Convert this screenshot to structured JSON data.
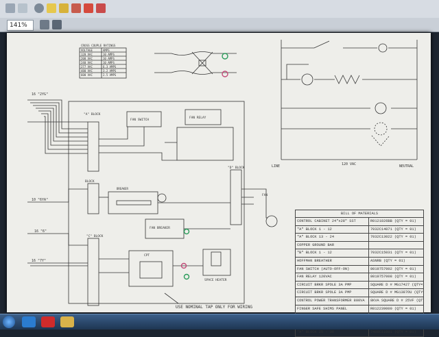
{
  "toolbar": {
    "zoom_value": "141%"
  },
  "drawing": {
    "wire_group_top": "16 \"2YG\"",
    "wire_group_mid1": "10 \"6YA\"",
    "wire_group_mid2": "16 \"6\"",
    "wire_group_bot": "16 \"7Y\"",
    "block_a": "\"A\" BLOCK",
    "block_b": "BLOCK",
    "block_c": "\"C\" BLOCK",
    "block_d": "\"D\" BLOCK",
    "fan_switch": "FAN SWITCH",
    "fan_relay": "FAN RELAY",
    "space_heater": "SPACE HEATER",
    "breaker": "BREAKER",
    "fan_breaker": "FAN BREAKER",
    "cpt": "CPT",
    "heater": "HEATER",
    "line_label": "LINE",
    "neutral_label": "NEUTRAL",
    "vac_label": "120 VAC",
    "fan_label": "FAN",
    "nominal_tap_note": "USE NOMINAL TAP ONLY FOR WIRING",
    "wire_size_title": "CROSS COUPLE RATINGS",
    "wire_size_rows": [
      [
        "VOLTAGE",
        "AMPS"
      ],
      [
        "120 VAC",
        "10 AMPS"
      ],
      [
        "208 VAC",
        "10 AMPS"
      ],
      [
        "240 VAC",
        "10 AMPS"
      ],
      [
        "277 VAC",
        "6.3 AMPS"
      ],
      [
        "480 VAC",
        "3.2 AMPS"
      ],
      [
        "600 VAC",
        "2.5 AMPS"
      ]
    ]
  },
  "bom": {
    "title": "BILL OF MATERIALS",
    "rows": [
      [
        "CONTROL CABINET 24\"x28\" SST",
        "R0121826BB (QTY = 01)"
      ],
      [
        "\"A\" BLOCK 1 - 12",
        "7032C14071 (QTY = 01)"
      ],
      [
        "\"A\" BLOCK 13 - 24",
        "7032C13022 (QTY = 01)"
      ],
      [
        "COPPER GROUND BAR",
        ""
      ],
      [
        "\"B\" BLOCK 1 - 12",
        "7032C15031 (QTY = 01)"
      ],
      [
        "HOFFMAN BREATHER",
        "ASNRB (QTY = 01)"
      ],
      [
        "FAN SWITCH (AUTO-OFF-ON)",
        "8019757002 (QTY = 01)"
      ],
      [
        "FAN RELAY 120VAC",
        "8019757008 (QTY = 01)"
      ],
      [
        "CIRCUIT BRKR SPOLE 3A PMP",
        "SQUARE D # MG17427 (QTY=1)"
      ],
      [
        "CIRCUIT BRKR SPOLE 3A PMP",
        "SQUARE D # MG1387OU (QTY=1)"
      ],
      [
        "CONTROL POWER TRANSFORMER 800VA",
        "8KVA SQUARE D # 25VF (QTY=1)"
      ],
      [
        "FINGER SAFE SHIMS PANEL",
        "R012239000 (QTY = 01)"
      ],
      [
        "SPACE HEATER",
        "7032803080 (QTY = 01)"
      ],
      [
        "THERMOSTAT",
        "R21807104 (QTY = 01)"
      ],
      [
        "\"A\" BLOCK 25 - 36",
        "7409C11001 (QTY = 01)"
      ]
    ]
  }
}
